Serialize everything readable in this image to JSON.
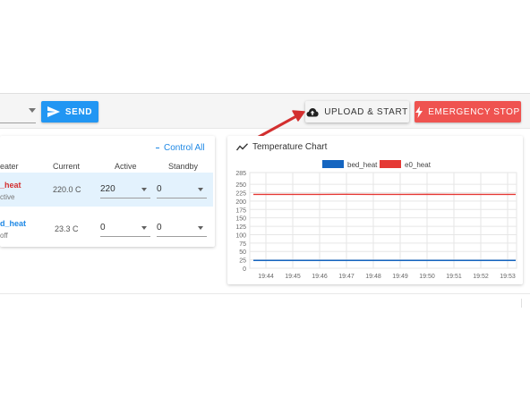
{
  "toolbar": {
    "send_label": "SEND",
    "upload_label": "UPLOAD & START",
    "estop_label": "EMERGENCY STOP"
  },
  "heaters": {
    "control_all": "Control All",
    "columns": {
      "heater": "eater",
      "current": "Current",
      "active": "Active",
      "standby": "Standby"
    },
    "rows": [
      {
        "name": "_heat",
        "state": "ctive",
        "current": "220.0 C",
        "active": "220",
        "standby": "0",
        "color": "#d32f2f"
      },
      {
        "name": "d_heat",
        "state": "off",
        "current": "23.3 C",
        "active": "0",
        "standby": "0",
        "color": "#1e88e5"
      }
    ]
  },
  "chart": {
    "title": "Temperature Chart"
  },
  "chart_data": {
    "type": "line",
    "x": [
      "19:44",
      "19:45",
      "19:46",
      "19:47",
      "19:48",
      "19:49",
      "19:50",
      "19:51",
      "19:52",
      "19:53"
    ],
    "ylim": [
      0,
      285
    ],
    "yticks": [
      0,
      25,
      50,
      75,
      100,
      125,
      150,
      175,
      200,
      225,
      250,
      285
    ],
    "grid": true,
    "legend_position": "top-center",
    "series": [
      {
        "name": "bed_heat",
        "values": [
          23.3,
          23.3,
          23.3,
          23.3,
          23.3,
          23.3,
          23.3,
          23.3,
          23.3,
          23.3
        ],
        "color": "#1565c0"
      },
      {
        "name": "e0_heat",
        "values": [
          220,
          220,
          219.8,
          220.2,
          220,
          219.9,
          220.1,
          220,
          219.9,
          220
        ],
        "color": "#e53935"
      }
    ]
  },
  "annotation": {
    "arrow_color": "#d32f2f"
  }
}
